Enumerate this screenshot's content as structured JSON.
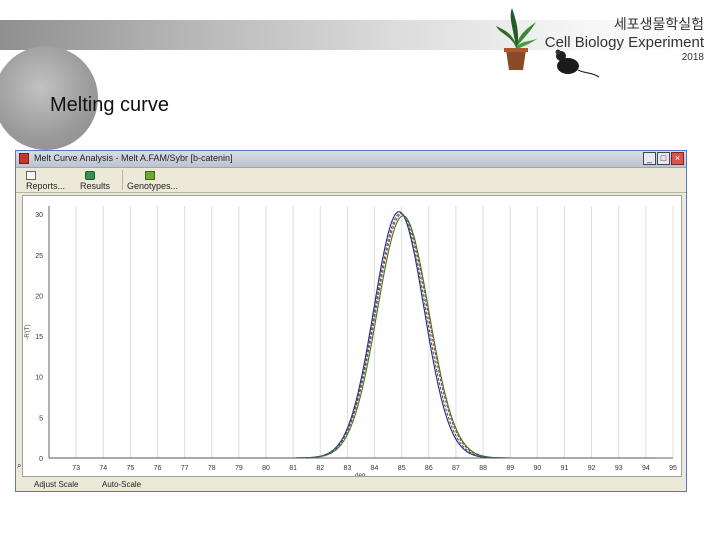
{
  "slide": {
    "title": "Melting curve",
    "header_kr": "세포생물학실험",
    "header_en": "Cell Biology Experiment",
    "year": "2018"
  },
  "window": {
    "title": "Melt Curve Analysis - Melt A.FAM/Sybr [b-catenin]",
    "controls": {
      "minimize": "_",
      "maximize": "□",
      "close": "×"
    },
    "toolbar": [
      {
        "label": "Reports...",
        "icon": "report-icon"
      },
      {
        "label": "Results",
        "icon": "results-icon"
      },
      {
        "label": "Genotypes...",
        "icon": "genotypes-icon"
      }
    ],
    "status": {
      "adjust_scale": "Adjust Scale",
      "auto_scale": "Auto-Scale"
    }
  },
  "chart_data": {
    "type": "line",
    "xlabel": "deg.",
    "ylabel": "-R'(T)",
    "xlim": [
      72,
      95
    ],
    "ylim": [
      0,
      31
    ],
    "x_ticks": [
      73,
      74,
      75,
      76,
      77,
      78,
      79,
      80,
      81,
      82,
      83,
      84,
      85,
      86,
      87,
      88,
      89,
      90,
      91,
      92,
      93,
      94,
      95
    ],
    "y_ticks": [
      0,
      5,
      10,
      15,
      20,
      25,
      30
    ],
    "grid": "vertical",
    "series": [
      {
        "color": "#1a2a8c",
        "peak_x": 84.9,
        "peak_y": 30.3,
        "width": 1.85
      },
      {
        "color": "#c0392b",
        "peak_x": 85.0,
        "peak_y": 30.0,
        "width": 1.9
      },
      {
        "color": "#2c7a2c",
        "peak_x": 85.05,
        "peak_y": 29.8,
        "width": 1.9
      },
      {
        "color": "#555555",
        "peak_x": 84.95,
        "peak_y": 30.1,
        "width": 1.87
      }
    ]
  }
}
